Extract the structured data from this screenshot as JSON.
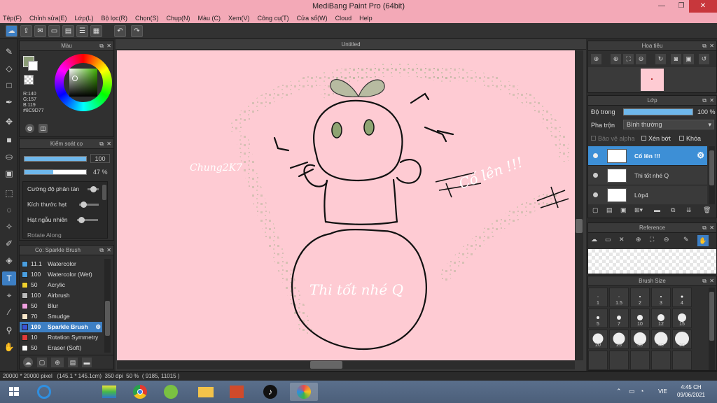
{
  "window": {
    "title": "MediBang Paint Pro (64bit)",
    "minimize": "—",
    "maximize": "❐",
    "close": "✕"
  },
  "menu": [
    "Tệp(F)",
    "Chỉnh sửa(E)",
    "Lớp(L)",
    "Bộ lọc(R)",
    "Chọn(S)",
    "Chụp(N)",
    "Màu (C)",
    "Xem(V)",
    "Công cụ(T)",
    "Cửa sổ(W)",
    "Cloud",
    "Help"
  ],
  "color_panel": {
    "title": "Màu",
    "r": "R:140",
    "g": "G:157",
    "b": "B:119",
    "hex": "#8C9D77",
    "fg_color": "#8C9D77"
  },
  "brush_control": {
    "title": "Kiểm soát cọ",
    "size_value": "100",
    "opacity_value": "47 %",
    "opacity_fraction": 0.47,
    "props": [
      "Cường độ phân tán",
      "Kích thước hạt",
      "Hạt ngẫu nhiên",
      "Rotate Along"
    ]
  },
  "brush_list": {
    "title": "Cọ: Sparkle Brush",
    "items": [
      {
        "size": "11.1",
        "name": "Watercolor",
        "color": "#4a9fe0"
      },
      {
        "size": "100",
        "name": "Watercolor (Wet)",
        "color": "#4a9fe0"
      },
      {
        "size": "50",
        "name": "Acrylic",
        "color": "#f2d22e"
      },
      {
        "size": "100",
        "name": "Airbrush",
        "color": "#bbbbbb"
      },
      {
        "size": "50",
        "name": "Blur",
        "color": "#f0a0e0"
      },
      {
        "size": "70",
        "name": "Smudge",
        "color": "#f7e6c8"
      },
      {
        "size": "100",
        "name": "Sparkle Brush",
        "color": "#3b53d6"
      },
      {
        "size": "10",
        "name": "Rotation Symmetry",
        "color": "#e03a3a"
      },
      {
        "size": "50",
        "name": "Eraser (Soft)",
        "color": "#ffffff"
      }
    ]
  },
  "canvas": {
    "tab": "Untitled",
    "text_name": "Chung2K7",
    "text_cheer": "Cố lên !!!",
    "text_exam": "Thi tốt nhé Q"
  },
  "navigator": {
    "title": "Hoa tiêu"
  },
  "layers": {
    "title": "Lớp",
    "opacity_label": "Độ trong",
    "opacity_value": "100 %",
    "blend_label": "Pha trộn",
    "blend_value": "Bình thường",
    "protect_alpha": "Bảo vệ alpha",
    "clipping": "Xén bớt",
    "lock": "Khóa",
    "items": [
      {
        "name": "Cố lên !!!",
        "selected": true
      },
      {
        "name": "Thi tốt nhé Q",
        "selected": false
      },
      {
        "name": "Lớp4",
        "selected": false
      }
    ]
  },
  "reference": {
    "title": "Reference"
  },
  "brush_size": {
    "title": "Brush Size",
    "sizes": [
      "1",
      "1.5",
      "2",
      "3",
      "4",
      "5",
      "7",
      "10",
      "12",
      "15",
      "20",
      "25",
      "30",
      "40",
      "50"
    ]
  },
  "status": {
    "dimensions": "20000 * 20000 pixel",
    "physical": "(145.1 * 145.1cm)",
    "dpi": "350 dpi",
    "zoom": "50 %",
    "coords": "( 9185, 11015 )"
  },
  "taskbar": {
    "lang": "VIE",
    "time": "4:45 CH",
    "date": "09/06/2021"
  }
}
